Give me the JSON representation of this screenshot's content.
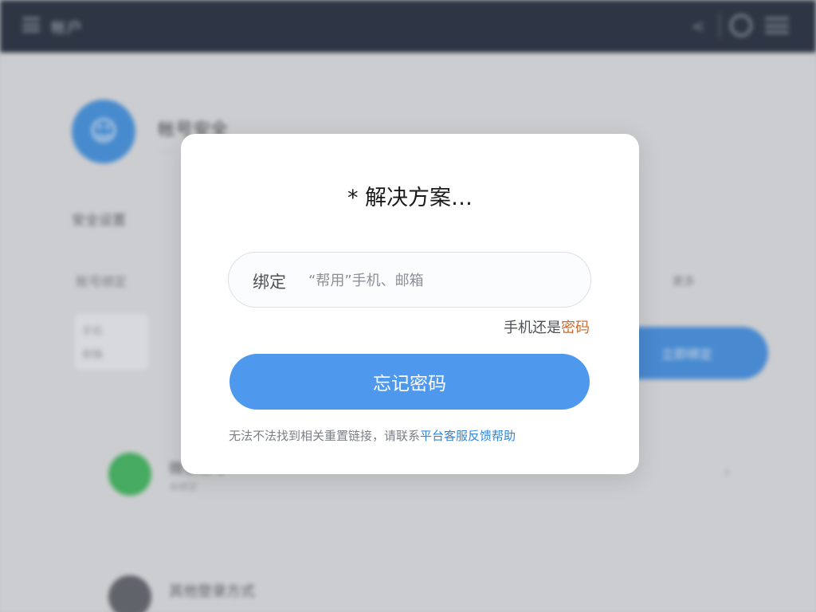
{
  "topbar": {
    "app_title": "帐户",
    "menu_icon": "menu-icon",
    "share_icon": "share-icon",
    "clock_icon": "clock-icon",
    "list_icon": "list-icon"
  },
  "background": {
    "profile_name": "帐号安全",
    "profile_sub": "......",
    "section_label": "安全设置",
    "filter_label": "账号绑定",
    "filter_right": "更多",
    "card_lines": [
      "手机",
      "邮箱"
    ],
    "blue_button_label": "立即绑定",
    "rows": [
      {
        "title": "微信账号",
        "sub": "未绑定",
        "avatar_color": "#3bb55a"
      },
      {
        "title": "其他登录方式",
        "sub": "",
        "avatar_color": "#5c5f66"
      }
    ]
  },
  "dialog": {
    "title": "* 解决方案…",
    "input_prefix": "绑定",
    "input_placeholder": "“帮用”手机、邮箱",
    "hint_text": "手机还是",
    "hint_link": "密码",
    "primary_button": "忘记密码",
    "footer_text": "无法不法找到相关重置链接，请联系",
    "footer_link": "平台客服反馈帮助"
  },
  "colors": {
    "topbar": "#1e2737",
    "primary": "#4e98ee",
    "link_orange": "#d16a2a",
    "link_blue": "#2f86d6"
  }
}
